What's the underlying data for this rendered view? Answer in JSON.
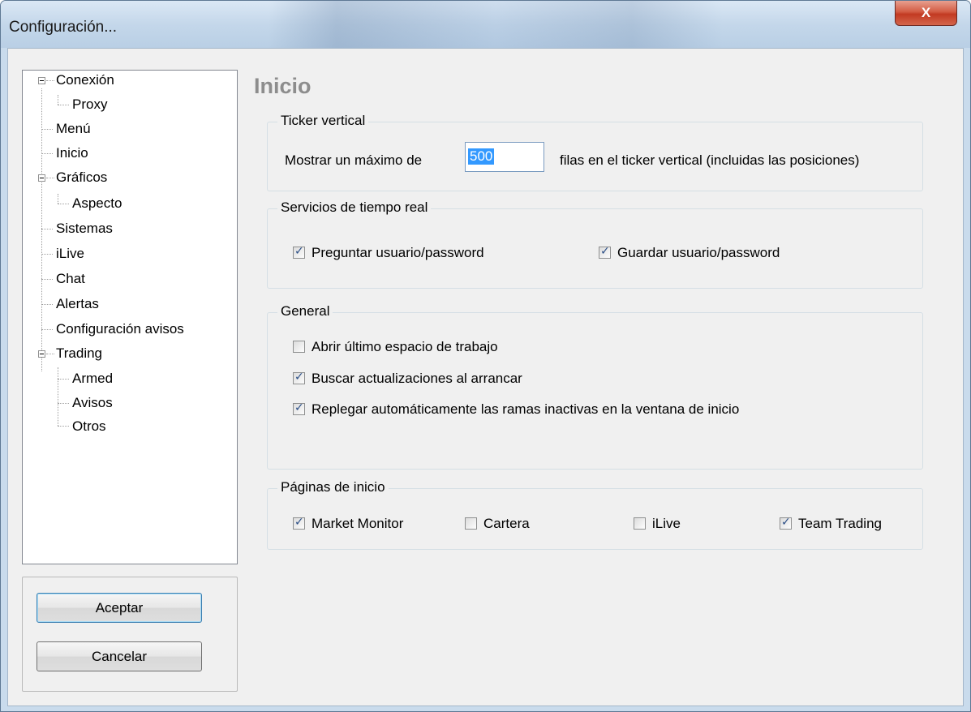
{
  "window": {
    "title": "Configuración...",
    "close_label": "X"
  },
  "tree": {
    "items": [
      {
        "label": "Conexión",
        "level": 0,
        "expanded": true
      },
      {
        "label": "Proxy",
        "level": 1
      },
      {
        "label": "Menú",
        "level": 0
      },
      {
        "label": "Inicio",
        "level": 0
      },
      {
        "label": "Gráficos",
        "level": 0,
        "expanded": true
      },
      {
        "label": "Aspecto",
        "level": 1
      },
      {
        "label": "Sistemas",
        "level": 0
      },
      {
        "label": "iLive",
        "level": 0
      },
      {
        "label": "Chat",
        "level": 0
      },
      {
        "label": "Alertas",
        "level": 0
      },
      {
        "label": "Configuración avisos",
        "level": 0
      },
      {
        "label": "Trading",
        "level": 0,
        "expanded": true
      },
      {
        "label": "Armed",
        "level": 1
      },
      {
        "label": "Avisos",
        "level": 1
      },
      {
        "label": "Otros",
        "level": 1
      }
    ]
  },
  "buttons": {
    "accept": "Aceptar",
    "cancel": "Cancelar"
  },
  "page": {
    "heading": "Inicio"
  },
  "ticker": {
    "group_label": "Ticker vertical",
    "prefix": "Mostrar un máximo de",
    "value": "500",
    "suffix": "filas en el ticker vertical (incluidas las posiciones)"
  },
  "realtime": {
    "group_label": "Servicios de tiempo real",
    "ask_label": "Preguntar usuario/password",
    "ask_checked": true,
    "save_label": "Guardar usuario/password",
    "save_checked": true
  },
  "general": {
    "group_label": "General",
    "open_workspace_label": "Abrir último espacio de trabajo",
    "open_workspace_checked": false,
    "check_updates_label": "Buscar actualizaciones al arrancar",
    "check_updates_checked": true,
    "collapse_label": "Replegar automáticamente las ramas inactivas en la ventana de inicio",
    "collapse_checked": true
  },
  "start_pages": {
    "group_label": "Páginas de inicio",
    "market_monitor_label": "Market Monitor",
    "market_monitor_checked": true,
    "cartera_label": "Cartera",
    "cartera_checked": false,
    "ilive_label": "iLive",
    "ilive_checked": false,
    "team_trading_label": "Team Trading",
    "team_trading_checked": true
  }
}
